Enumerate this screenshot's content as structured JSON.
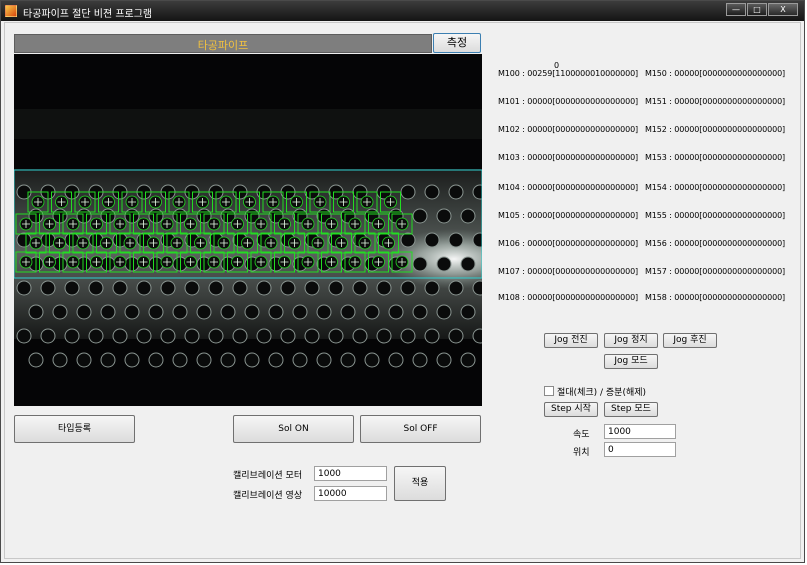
{
  "window": {
    "title": "타공파이프 절단 비젼 프로그램",
    "buttons": [
      "—",
      "□",
      "X"
    ]
  },
  "header": {
    "title": "타공파이프",
    "measure_button": "측정"
  },
  "plc": {
    "zero_label": "0",
    "left": [
      "M100 : 00259[1100000010000000]",
      "M101 : 00000[0000000000000000]",
      "M102 : 00000[0000000000000000]",
      "M103 : 00000[0000000000000000]",
      "M104 : 00000[0000000000000000]",
      "M105 : 00000[0000000000000000]",
      "M106 : 00000[0000000000000000]",
      "M107 : 00000[0000000000000000]",
      "M108 : 00000[0000000000000000]"
    ],
    "right": [
      "M150 : 00000[0000000000000000]",
      "M151 : 00000[0000000000000000]",
      "M152 : 00000[0000000000000000]",
      "M153 : 00000[0000000000000000]",
      "M154 : 00000[0000000000000000]",
      "M155 : 00000[0000000000000000]",
      "M156 : 00000[0000000000000000]",
      "M157 : 00000[0000000000000000]",
      "M158 : 00000[0000000000000000]"
    ]
  },
  "jog": {
    "forward": "Jog 전진",
    "stop": "Jog 정지",
    "backward": "Jog 후진",
    "mode": "Jog 모드"
  },
  "step": {
    "checkbox_label": "절대(체크) / 증분(해제)",
    "start": "Step 시작",
    "mode": "Step 모드",
    "speed_label": "속도",
    "speed_value": "1000",
    "position_label": "위치",
    "position_value": "0"
  },
  "bottom": {
    "type_register": "타입등록",
    "sol_on": "Sol ON",
    "sol_off": "Sol OFF",
    "calib_motor_label": "캘리브레이션 모터",
    "calib_motor_value": "1000",
    "calib_image_label": "캘리브레이션 영상",
    "calib_image_value": "10000",
    "apply": "적용"
  },
  "colors": {
    "header_text": "#f0c040",
    "detection_box": "#22dd22",
    "roi_line": "#2fd0d0"
  }
}
